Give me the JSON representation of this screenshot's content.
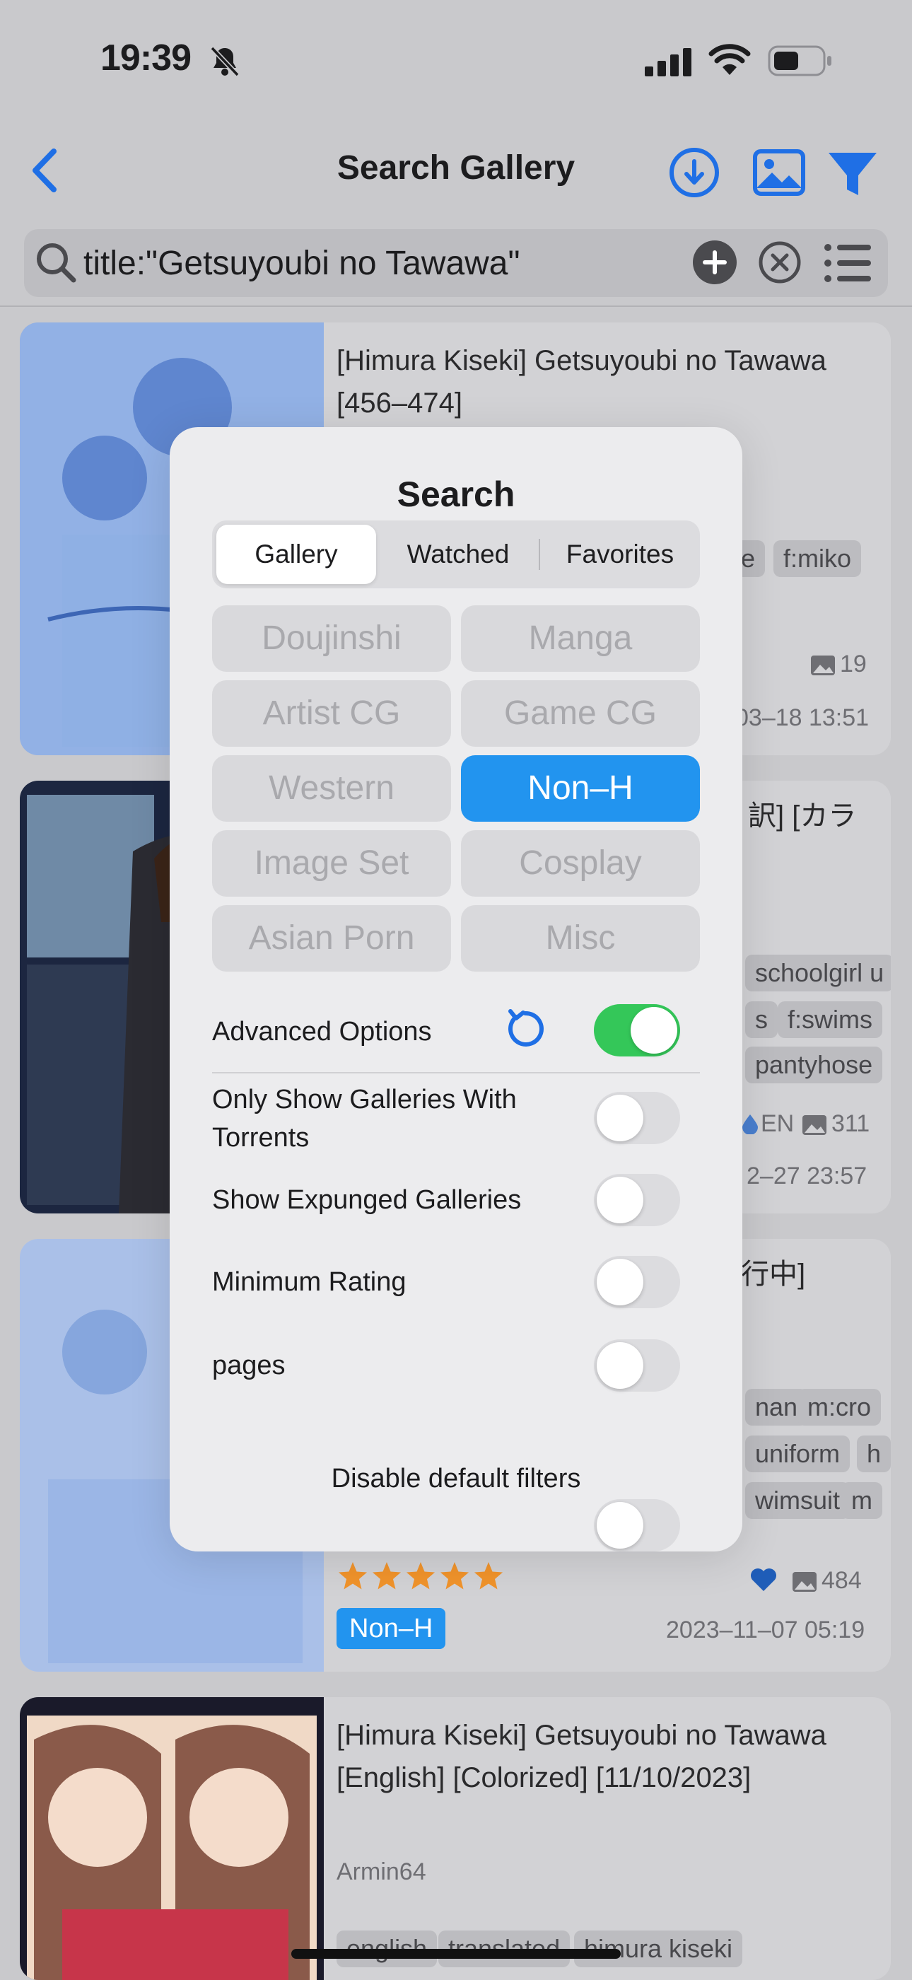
{
  "status_bar": {
    "time": "19:39"
  },
  "nav": {
    "title": "Search Gallery"
  },
  "search": {
    "value": "title:\"Getsuyoubi no Tawawa\""
  },
  "cards": [
    {
      "title": "[Himura Kiseki] Getsuyoubi no Tawawa [456–474]",
      "tags": [
        "ie",
        "f:miko"
      ],
      "pages": "19",
      "date": "03–18 13:51"
    },
    {
      "title_partial": "訳] [カラ",
      "tags_row1": [
        "schoolgirl u"
      ],
      "tags_row2": [
        "s",
        "f:swims"
      ],
      "tags_row3": [
        "pantyhose"
      ],
      "language": "EN",
      "pages": "311",
      "date": "2–27 23:57"
    },
    {
      "title_partial": "行中]",
      "tags_row1": [
        "nan",
        "m:cro"
      ],
      "tags_row2": [
        "uniform",
        "h"
      ],
      "tags_row3": [
        "wimsuit",
        "m"
      ],
      "rating": 5,
      "category": "Non–H",
      "pages": "484",
      "date": "2023–11–07 05:19"
    },
    {
      "title": "[Himura Kiseki] Getsuyoubi no Tawawa [English] [Colorized] [11/10/2023]",
      "uploader": "Armin64",
      "tags": [
        "english",
        "translated",
        "himura kiseki"
      ]
    }
  ],
  "modal": {
    "title": "Search",
    "segments": [
      "Gallery",
      "Watched",
      "Favorites"
    ],
    "selected_segment": "Gallery",
    "categories": [
      {
        "label": "Doujinshi",
        "on": false
      },
      {
        "label": "Manga",
        "on": false
      },
      {
        "label": "Artist CG",
        "on": false
      },
      {
        "label": "Game CG",
        "on": false
      },
      {
        "label": "Western",
        "on": false
      },
      {
        "label": "Non–H",
        "on": true
      },
      {
        "label": "Image Set",
        "on": false
      },
      {
        "label": "Cosplay",
        "on": false
      },
      {
        "label": "Asian Porn",
        "on": false
      },
      {
        "label": "Misc",
        "on": false
      }
    ],
    "advanced_options": {
      "label": "Advanced Options",
      "on": true
    },
    "toggles": [
      {
        "label": "Only Show Galleries With Torrents",
        "on": false
      },
      {
        "label": "Show Expunged Galleries",
        "on": false
      },
      {
        "label": "Minimum Rating",
        "on": false
      },
      {
        "label": "pages",
        "on": false
      }
    ],
    "disable_default_filters": "Disable default filters"
  },
  "colors": {
    "accent": "#2294ef",
    "toggle_on": "#34c759",
    "star": "#f0932b"
  }
}
